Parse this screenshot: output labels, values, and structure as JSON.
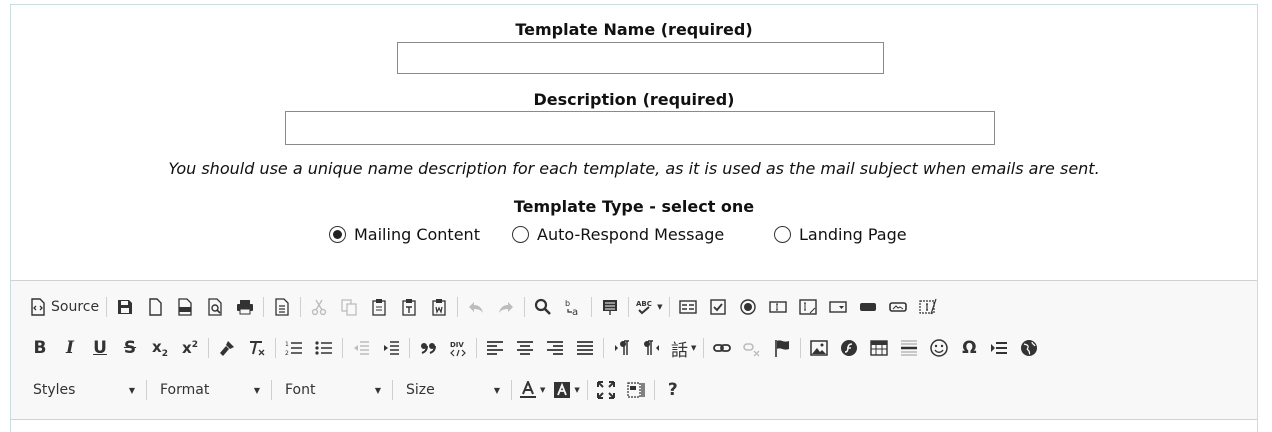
{
  "form": {
    "template_name_label": "Template Name (required)",
    "template_name_value": "",
    "description_label": "Description (required)",
    "description_value": "",
    "note": "You should use a unique name description for each template, as it is used as the mail subject when emails are sent.",
    "template_type_label": "Template Type - select one",
    "template_types": [
      {
        "label": "Mailing Content",
        "selected": true
      },
      {
        "label": "Auto-Respond Message",
        "selected": false
      },
      {
        "label": "Landing Page",
        "selected": false
      }
    ]
  },
  "toolbar": {
    "source_label": "Source",
    "row1_icons": [
      "source-icon",
      "save-icon",
      "new-page-icon",
      "export-pdf-icon",
      "preview-icon",
      "print-icon",
      "templates-icon",
      "cut-icon",
      "copy-icon",
      "paste-icon",
      "paste-text-icon",
      "paste-word-icon",
      "undo-icon",
      "redo-icon",
      "find-icon",
      "replace-icon",
      "select-all-icon",
      "spellcheck-icon",
      "form-icon",
      "checkbox-icon",
      "radio-icon",
      "textfield-icon",
      "textarea-icon",
      "select-field-icon",
      "button-icon",
      "image-button-icon",
      "hidden-field-icon"
    ],
    "row2_icons": [
      "bold-icon",
      "italic-icon",
      "underline-icon",
      "strike-icon",
      "subscript-icon",
      "superscript-icon",
      "copy-format-icon",
      "remove-format-icon",
      "numbered-list-icon",
      "bulleted-list-icon",
      "outdent-icon",
      "indent-icon",
      "blockquote-icon",
      "create-div-icon",
      "align-left-icon",
      "align-center-icon",
      "align-right-icon",
      "justify-icon",
      "ltr-icon",
      "rtl-icon",
      "language-icon",
      "link-icon",
      "unlink-icon",
      "anchor-icon",
      "image-icon",
      "flash-icon",
      "table-icon",
      "horizontal-rule-icon",
      "smiley-icon",
      "special-char-icon",
      "page-break-icon",
      "iframe-icon"
    ],
    "combos": [
      {
        "label": "Styles"
      },
      {
        "label": "Format"
      },
      {
        "label": "Font"
      },
      {
        "label": "Size"
      }
    ],
    "row3_icons": [
      "text-color-icon",
      "background-color-icon",
      "maximize-icon",
      "show-blocks-icon",
      "about-icon"
    ]
  }
}
